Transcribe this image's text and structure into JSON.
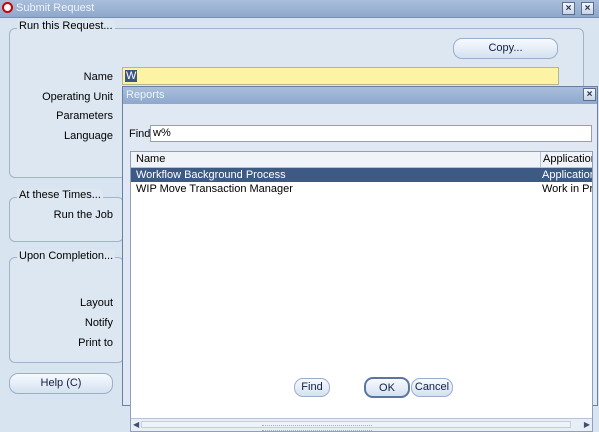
{
  "window": {
    "title": "Submit Request",
    "controls": [
      "×",
      "×"
    ]
  },
  "form": {
    "section_request": "Run this Request...",
    "copy_button": "Copy...",
    "labels": {
      "name": "Name",
      "operating_unit": "Operating Unit",
      "parameters": "Parameters",
      "language": "Language"
    },
    "name_value": "W",
    "section_times": "At these Times...",
    "run_the_job": "Run the Job",
    "section_completion": "Upon Completion...",
    "labels2": {
      "layout": "Layout",
      "notify": "Notify",
      "print_to": "Print to"
    },
    "help_button": "Help (C)"
  },
  "dialog": {
    "title": "Reports",
    "close": "×",
    "find_label": "Find",
    "find_value": "w%",
    "columns": [
      "Name",
      "Application"
    ],
    "rows": [
      {
        "name": "Workflow Background Process",
        "application": "Application",
        "selected": true
      },
      {
        "name": "WIP Move Transaction Manager",
        "application": "Work in Pro",
        "selected": false
      }
    ],
    "buttons": {
      "find": "Find",
      "ok": "OK",
      "cancel": "Cancel"
    }
  },
  "colors": {
    "accent": "#3d5a85",
    "title_bar": "#8ea8cd",
    "name_field": "#fdf3a5"
  }
}
